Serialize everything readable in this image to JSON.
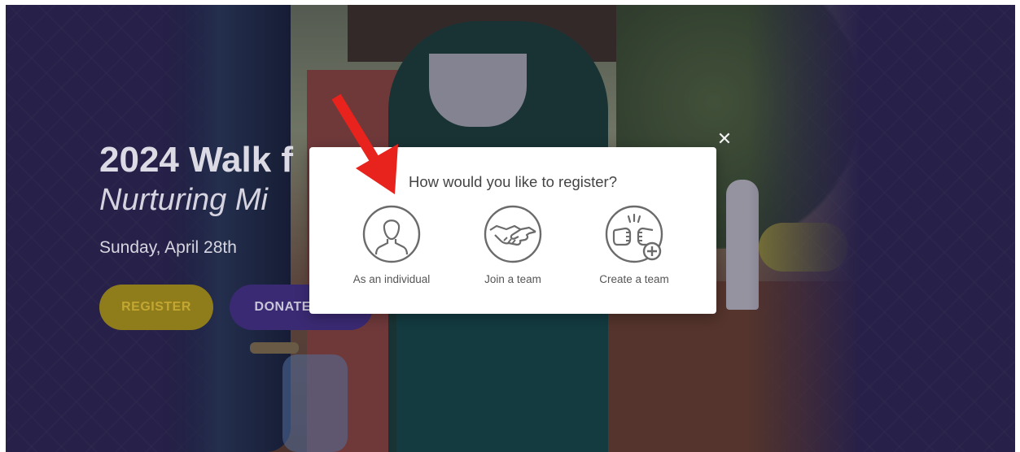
{
  "hero": {
    "title": "2024 Walk f",
    "subtitle": "Nurturing Mi",
    "date": "Sunday, April 28th",
    "register_label": "REGISTER",
    "donate_label": "DONATE NOW"
  },
  "modal": {
    "title": "How would you like to register?",
    "close_icon": "close-icon",
    "options": [
      {
        "label": "As an individual",
        "icon": "person-icon"
      },
      {
        "label": "Join a team",
        "icon": "handshake-icon"
      },
      {
        "label": "Create a team",
        "icon": "fist-bump-plus-icon"
      }
    ]
  },
  "annotation": {
    "icon": "red-arrow-icon",
    "color": "#e8221c"
  },
  "colors": {
    "background_purple": "#352d5e",
    "register_button": "#8f7d1c",
    "donate_button": "#3a2a73",
    "modal_icon_gray": "#6b6b6b"
  }
}
